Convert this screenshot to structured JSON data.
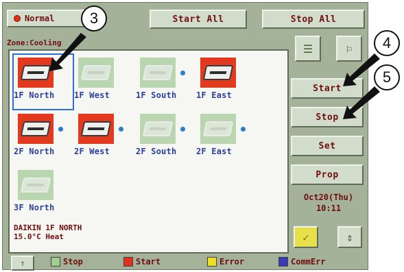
{
  "header": {
    "mode_label": "Normal",
    "start_all_label": "Start All",
    "stop_all_label": "Stop All"
  },
  "zone_label": "Zone:Cooling",
  "units": [
    {
      "name": "1F North",
      "status": "start",
      "selected": true
    },
    {
      "name": "1F West",
      "status": "stop"
    },
    {
      "name": "1F South",
      "status": "stop"
    },
    {
      "name": "1F East",
      "status": "start"
    },
    {
      "name": "2F North",
      "status": "start"
    },
    {
      "name": "2F West",
      "status": "start"
    },
    {
      "name": "2F South",
      "status": "stop"
    },
    {
      "name": "2F East",
      "status": "stop"
    },
    {
      "name": "3F North",
      "status": "stop"
    }
  ],
  "selected_info": {
    "line1": "DAIKIN 1F NORTH",
    "line2": "15.0°C  Heat"
  },
  "side_buttons": {
    "start_label": "Start",
    "stop_label": "Stop",
    "set_label": "Set",
    "prop_label": "Prop"
  },
  "datetime": {
    "date": "Oct20(Thu)",
    "time": "10:11"
  },
  "legend": [
    {
      "label": "Stop",
      "color": "#9fd08f"
    },
    {
      "label": "Start",
      "color": "#e0301e"
    },
    {
      "label": "Error",
      "color": "#f0e020"
    },
    {
      "label": "CommErr",
      "color": "#3a3ab8"
    }
  ],
  "callouts": [
    "3",
    "4",
    "5"
  ],
  "colors": {
    "panel_bg": "#a5b29a",
    "start_tile": "#e33a1f",
    "stop_tile": "#b9d6b0",
    "selection": "#2b6fd6"
  },
  "icons": {
    "list_view": "list-view-icon",
    "tree_view": "tree-view-icon",
    "yellow_square": "yellow-status-icon",
    "scroll_down": "scroll-down-icon",
    "scroll_up": "scroll-up-icon"
  }
}
